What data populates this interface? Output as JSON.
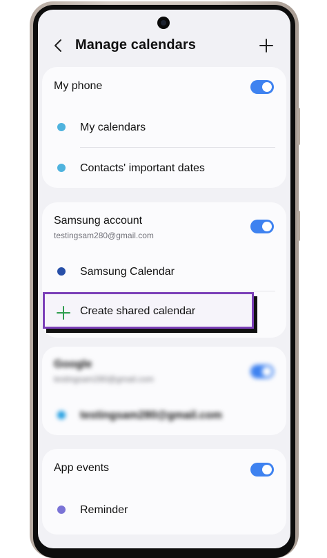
{
  "header": {
    "title": "Manage calendars"
  },
  "my_phone": {
    "label": "My phone",
    "toggle_on": true,
    "items": [
      {
        "label": "My calendars",
        "color": "#4fb3de"
      },
      {
        "label": "Contacts' important dates",
        "color": "#4fb3de"
      }
    ]
  },
  "samsung": {
    "label": "Samsung account",
    "email": "testingsam280@gmail.com",
    "toggle_on": true,
    "items": [
      {
        "label": "Samsung Calendar",
        "color": "#274fa8"
      }
    ],
    "create_shared_label": "Create shared calendar"
  },
  "google": {
    "label": "Google",
    "email": "testingsam280@gmail.com",
    "toggle_on": true,
    "items": [
      {
        "label": "testingsam280@gmail.com",
        "color": "#1a9be0"
      }
    ]
  },
  "app_events": {
    "label": "App events",
    "toggle_on": true,
    "items": [
      {
        "label": "Reminder",
        "color": "#7a73d6"
      }
    ]
  },
  "colors": {
    "accent": "#3e82f0",
    "highlight_border": "#7b3fb8",
    "plus_green": "#2e9d4e"
  },
  "icons": {
    "back": "chevron-left-icon",
    "add": "plus-icon",
    "create": "plus-icon"
  }
}
